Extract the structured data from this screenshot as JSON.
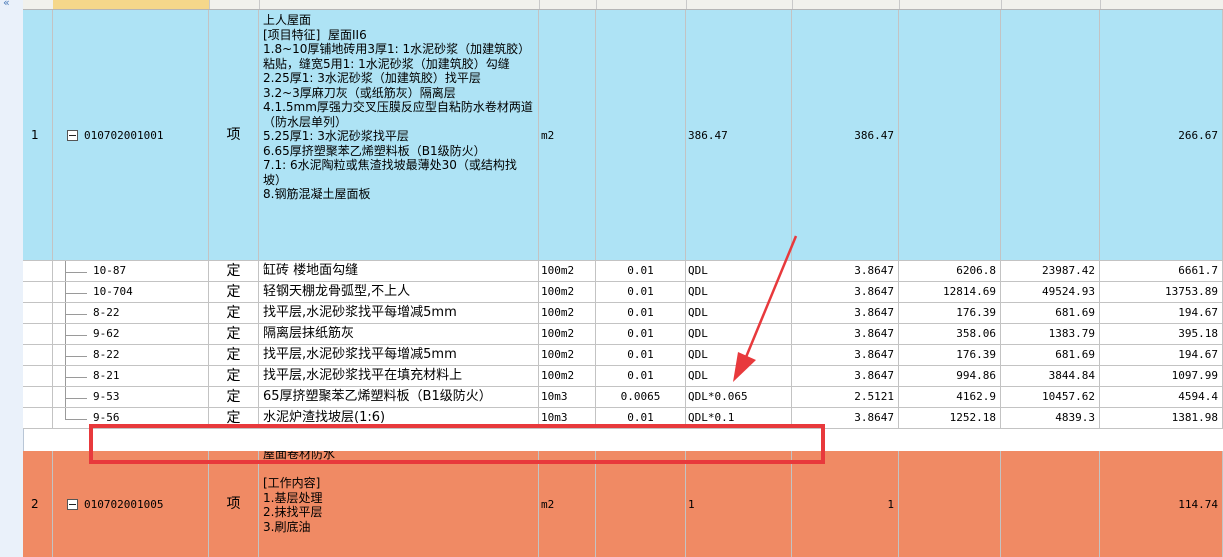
{
  "rows": {
    "r1": {
      "index": "1",
      "code": "010702001001",
      "type": "项",
      "description": "上人屋面\n[项目特征]  屋面II6\n1.8~10厚铺地砖用3厚1: 1水泥砂浆（加建筑胶）粘贴，缝宽5用1: 1水泥砂浆（加建筑胶）勾缝\n2.25厚1: 3水泥砂浆（加建筑胶）找平层\n3.2~3厚麻刀灰（或纸筋灰）隔离层\n4.1.5mm厚强力交叉压膜反应型自粘防水卷材两道（防水层单列）\n5.25厚1: 3水泥砂浆找平层\n6.65厚挤塑聚苯乙烯塑料板（B1级防火）\n7.1: 6水泥陶粒或焦渣找坡最薄处30（或结构找坡）\n8.钢筋混凝土屋面板",
      "unit": "m2",
      "coef": "",
      "expr": "386.47",
      "qty": "386.47",
      "price": "",
      "total": "",
      "unit_total": "266.67"
    },
    "subrows": [
      {
        "code": "10-87",
        "type": "定",
        "name": "缸砖 楼地面勾缝",
        "unit": "100m2",
        "coef": "0.01",
        "expr": "QDL",
        "qty": "3.8647",
        "price": "6206.8",
        "total": "23987.42",
        "unit_total": "6661.7"
      },
      {
        "code": "10-704",
        "type": "定",
        "name": "轻钢天棚龙骨弧型,不上人",
        "unit": "100m2",
        "coef": "0.01",
        "expr": "QDL",
        "qty": "3.8647",
        "price": "12814.69",
        "total": "49524.93",
        "unit_total": "13753.89"
      },
      {
        "code": "8-22",
        "type": "定",
        "name": "找平层,水泥砂浆找平每增减5mm",
        "unit": "100m2",
        "coef": "0.01",
        "expr": "QDL",
        "qty": "3.8647",
        "price": "176.39",
        "total": "681.69",
        "unit_total": "194.67"
      },
      {
        "code": "9-62",
        "type": "定",
        "name": "隔离层抹纸筋灰",
        "unit": "100m2",
        "coef": "0.01",
        "expr": "QDL",
        "qty": "3.8647",
        "price": "358.06",
        "total": "1383.79",
        "unit_total": "395.18"
      },
      {
        "code": "8-22",
        "type": "定",
        "name": "找平层,水泥砂浆找平每增减5mm",
        "unit": "100m2",
        "coef": "0.01",
        "expr": "QDL",
        "qty": "3.8647",
        "price": "176.39",
        "total": "681.69",
        "unit_total": "194.67"
      },
      {
        "code": "8-21",
        "type": "定",
        "name": "找平层,水泥砂浆找平在填充材料上",
        "unit": "100m2",
        "coef": "0.01",
        "expr": "QDL",
        "qty": "3.8647",
        "price": "994.86",
        "total": "3844.84",
        "unit_total": "1097.99"
      },
      {
        "code": "9-53",
        "type": "定",
        "name": "65厚挤塑聚苯乙烯塑料板（B1级防火）",
        "unit": "10m3",
        "coef": "0.0065",
        "expr": "QDL*0.065",
        "qty": "2.5121",
        "price": "4162.9",
        "total": "10457.62",
        "unit_total": "4594.4"
      },
      {
        "code": "9-56",
        "type": "定",
        "name": "水泥炉渣找坡层(1:6)",
        "unit": "10m3",
        "coef": "0.01",
        "expr": "QDL*0.1",
        "qty": "3.8647",
        "price": "1252.18",
        "total": "4839.3",
        "unit_total": "1381.98"
      }
    ],
    "r2": {
      "index": "2",
      "code": "010702001005",
      "type": "项",
      "description": "屋面卷材防水\n\n[工作内容]\n1.基层处理\n2.抹找平层\n3.刷底油",
      "unit": "m2",
      "expr": "1",
      "qty": "1",
      "unit_total": "114.74"
    }
  },
  "colors": {
    "row_selected": "#aee3f5",
    "row_orange": "#f08a64",
    "highlight": "#e8393c"
  }
}
